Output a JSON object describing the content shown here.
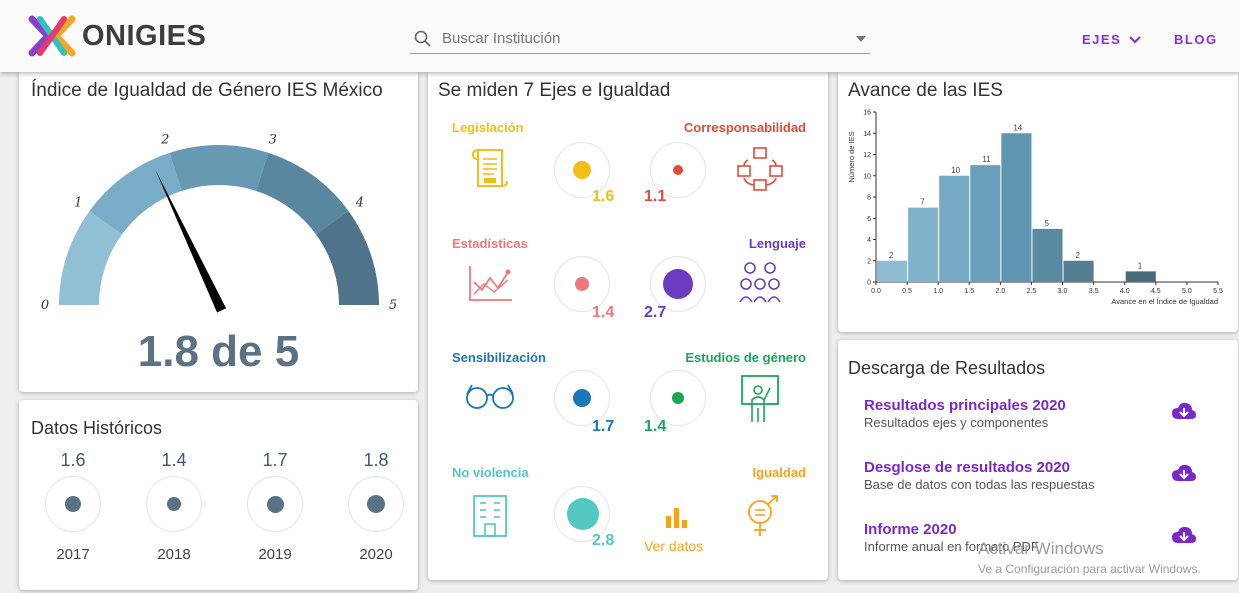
{
  "header": {
    "logo_text": "ONIGIES",
    "search_placeholder": "Buscar Institución",
    "nav": {
      "ejes": "EJES",
      "blog": "BLOG"
    }
  },
  "gauge_card": {
    "title": "Índice de Igualdad de Género IES México",
    "ticks": [
      "0",
      "1",
      "2",
      "3",
      "4",
      "5"
    ],
    "value": 1.8,
    "max": 5,
    "value_text": "1.8 de 5",
    "colors": [
      "#91bfd6",
      "#79adc7",
      "#6799b3",
      "#5a86a0",
      "#4f738a"
    ]
  },
  "history_card": {
    "title": "Datos Históricos",
    "items": [
      {
        "value": "1.6",
        "year": "2017"
      },
      {
        "value": "1.4",
        "year": "2018"
      },
      {
        "value": "1.7",
        "year": "2019"
      },
      {
        "value": "1.8",
        "year": "2020"
      }
    ]
  },
  "axes_card": {
    "title": "Se miden 7 Ejes e Igualdad",
    "axes": [
      {
        "name": "Legislación",
        "value": "1.6",
        "color": "#f4be1a",
        "icon": "scroll-icon"
      },
      {
        "name": "Corresponsabilidad",
        "value": "1.1",
        "color": "#e04b3a",
        "icon": "family-network-icon"
      },
      {
        "name": "Estadísticas",
        "value": "1.4",
        "color": "#f0787a",
        "icon": "line-chart-icon"
      },
      {
        "name": "Lenguaje",
        "value": "2.7",
        "color": "#6a3cc0",
        "icon": "people-talking-icon"
      },
      {
        "name": "Sensibilización",
        "value": "1.7",
        "color": "#1a77b8",
        "icon": "glasses-icon"
      },
      {
        "name": "Estudios de género",
        "value": "1.4",
        "color": "#19a55a",
        "icon": "teacher-board-icon"
      },
      {
        "name": "No violencia",
        "value": "2.8",
        "color": "#52c8c0",
        "icon": "building-icon"
      },
      {
        "name": "Igualdad",
        "value": "",
        "color": "#f6a21c",
        "icon": "gender-equality-icon"
      }
    ],
    "ver_datos": "Ver datos"
  },
  "progress_card": {
    "title": "Avance de las IES"
  },
  "chart_data": {
    "type": "bar",
    "title": "",
    "xlabel": "Avance en el Índice de Igualdad",
    "ylabel": "Número de IES",
    "x_ticks": [
      "0.0",
      "0.5",
      "1.0",
      "1.5",
      "2.0",
      "2.5",
      "3.0",
      "3.5",
      "4.0",
      "4.5",
      "5.0",
      "5.5"
    ],
    "y_ticks": [
      "0",
      "2",
      "4",
      "6",
      "8",
      "10",
      "12",
      "14",
      "16"
    ],
    "ylim": [
      0,
      16
    ],
    "bins": [
      {
        "start": 0.0,
        "end": 0.5,
        "count": 2
      },
      {
        "start": 0.5,
        "end": 1.0,
        "count": 7
      },
      {
        "start": 1.0,
        "end": 1.5,
        "count": 10
      },
      {
        "start": 1.5,
        "end": 2.0,
        "count": 11
      },
      {
        "start": 2.0,
        "end": 2.5,
        "count": 14
      },
      {
        "start": 2.5,
        "end": 3.0,
        "count": 5
      },
      {
        "start": 3.0,
        "end": 3.5,
        "count": 2
      },
      {
        "start": 3.5,
        "end": 4.0,
        "count": 0
      },
      {
        "start": 4.0,
        "end": 4.5,
        "count": 1
      }
    ],
    "colors": [
      "#8fbcd4",
      "#82b3cc",
      "#76a9c4",
      "#6aa0bb",
      "#5f96b1",
      "#5a8aa2",
      "#557e92",
      "#4f7385",
      "#4a6b7c"
    ]
  },
  "downloads_card": {
    "title": "Descarga de Resultados",
    "items": [
      {
        "title": "Resultados principales 2020",
        "subtitle": "Resultados ejes y componentes"
      },
      {
        "title": "Desglose de resultados 2020",
        "subtitle": "Base de datos con todas las respuestas"
      },
      {
        "title": "Informe 2020",
        "subtitle": "Informe anual en formato PDF"
      }
    ]
  },
  "watermark": {
    "line1": "Activar Windows",
    "line2": "Ve a Configuración para activar Windows."
  }
}
